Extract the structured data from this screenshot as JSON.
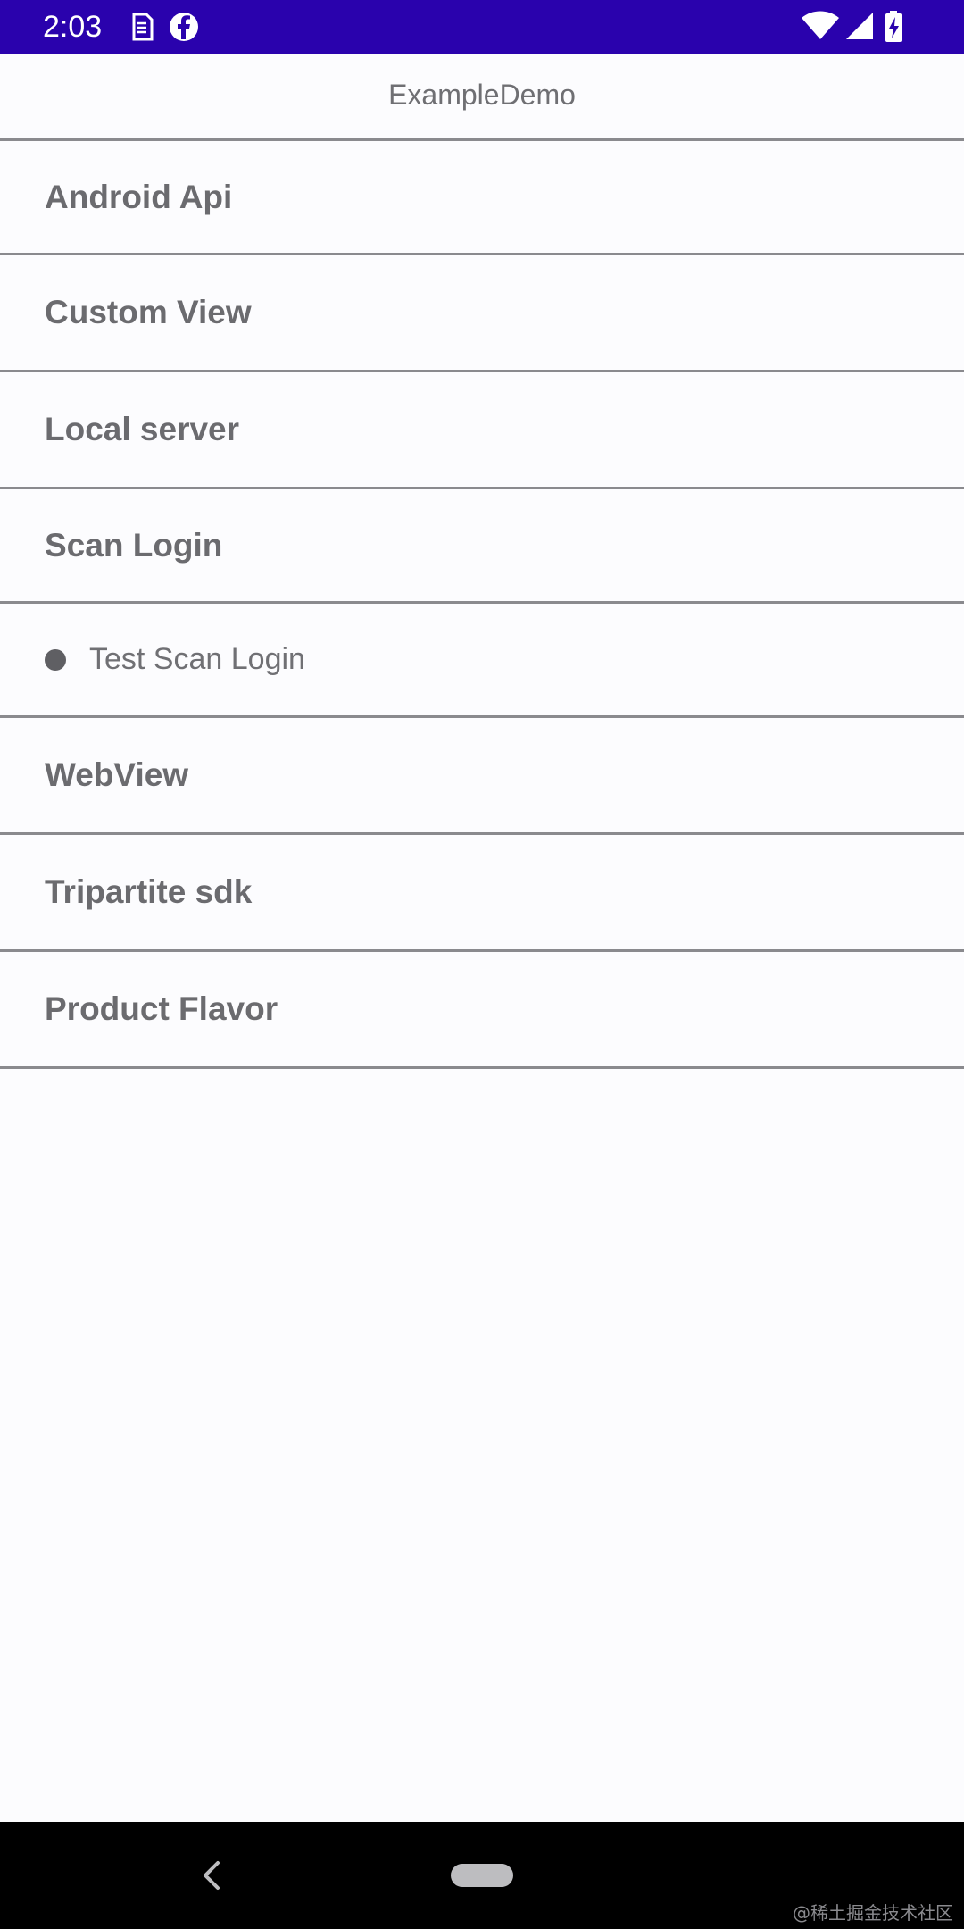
{
  "status_bar": {
    "time": "2:03",
    "background": "#2a02ad",
    "left_icons": [
      "sim-card-icon",
      "facebook-icon"
    ],
    "right_icons": [
      "wifi-icon",
      "cell-signal-icon",
      "battery-charging-icon"
    ]
  },
  "app_bar": {
    "title": "ExampleDemo"
  },
  "menu": {
    "items": [
      {
        "label": "Android Api"
      },
      {
        "label": "Custom View"
      },
      {
        "label": "Local server"
      },
      {
        "label": "Scan Login"
      },
      {
        "label": "Test Scan Login"
      },
      {
        "label": "WebView"
      },
      {
        "label": "Tripartite sdk"
      },
      {
        "label": "Product Flavor"
      }
    ]
  },
  "nav_bar": {
    "icons": [
      "back-icon",
      "home-pill-icon"
    ],
    "watermark": "@稀土掘金技术社区"
  }
}
